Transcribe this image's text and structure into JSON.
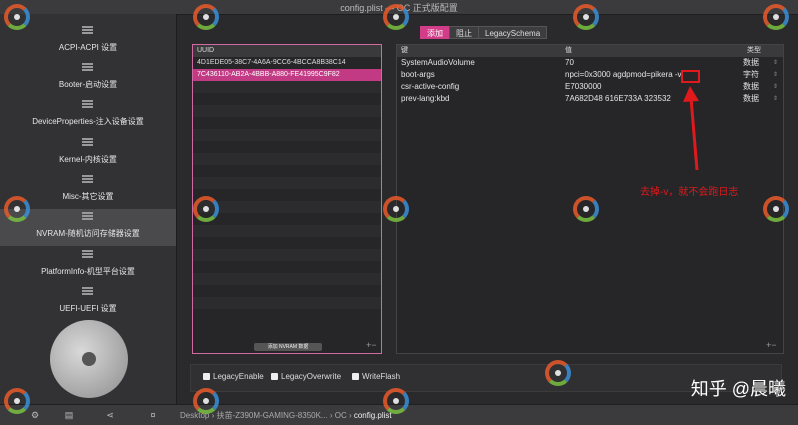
{
  "window": {
    "title": "config.plist — OC 正式版配置"
  },
  "sidebar": {
    "items": [
      {
        "label": "ACPI-ACPI 设置"
      },
      {
        "label": "Booter-启动设置"
      },
      {
        "label": "DeviceProperties-注入设备设置"
      },
      {
        "label": "Kernel-内核设置"
      },
      {
        "label": "Misc-其它设置"
      },
      {
        "label": "NVRAM-随机访问存储器设置",
        "active": true
      },
      {
        "label": "PlatformInfo-机型平台设置"
      },
      {
        "label": "UEFI-UEFI 设置"
      }
    ]
  },
  "uuid_panel": {
    "header": "UUID",
    "rows": [
      "4D1EDE05-38C7-4A6A-9CC6-4BCCA8B38C14",
      "7C436110-AB2A-4BBB-A880-FE41995C9F82"
    ],
    "add_button": "添加 NVRAM 数据"
  },
  "tabs": [
    "添加",
    "阻止",
    "LegacySchema"
  ],
  "kv_panel": {
    "headers": {
      "key": "键",
      "value": "值",
      "type": "类型"
    },
    "rows": [
      {
        "key": "SystemAudioVolume",
        "value": "70",
        "type": "数据"
      },
      {
        "key": "boot-args",
        "value": "npci=0x3000 agdpmod=pikera -v",
        "type": "字符"
      },
      {
        "key": "csr-active-config",
        "value": "E7030000",
        "type": "数据"
      },
      {
        "key": "prev-lang:kbd",
        "value": "7A682D48 616E733A 323532",
        "type": "数据"
      }
    ]
  },
  "annotation": {
    "text": "去掉-v，就不会跑日志",
    "color": "#e0191c"
  },
  "checkboxes": [
    "LegacyEnable",
    "LegacyOverwrite",
    "WriteFlash"
  ],
  "path_bar": {
    "segments": [
      "Desktop",
      "扶苗-Z390M-GAMING-8350K...",
      "OC"
    ],
    "file": "config.plist"
  },
  "watermark": {
    "text": "知乎 @晨曦"
  },
  "colors": {
    "accent": "#d23d8a",
    "selection": "#c23a84",
    "annotation_red": "#e0191c"
  }
}
